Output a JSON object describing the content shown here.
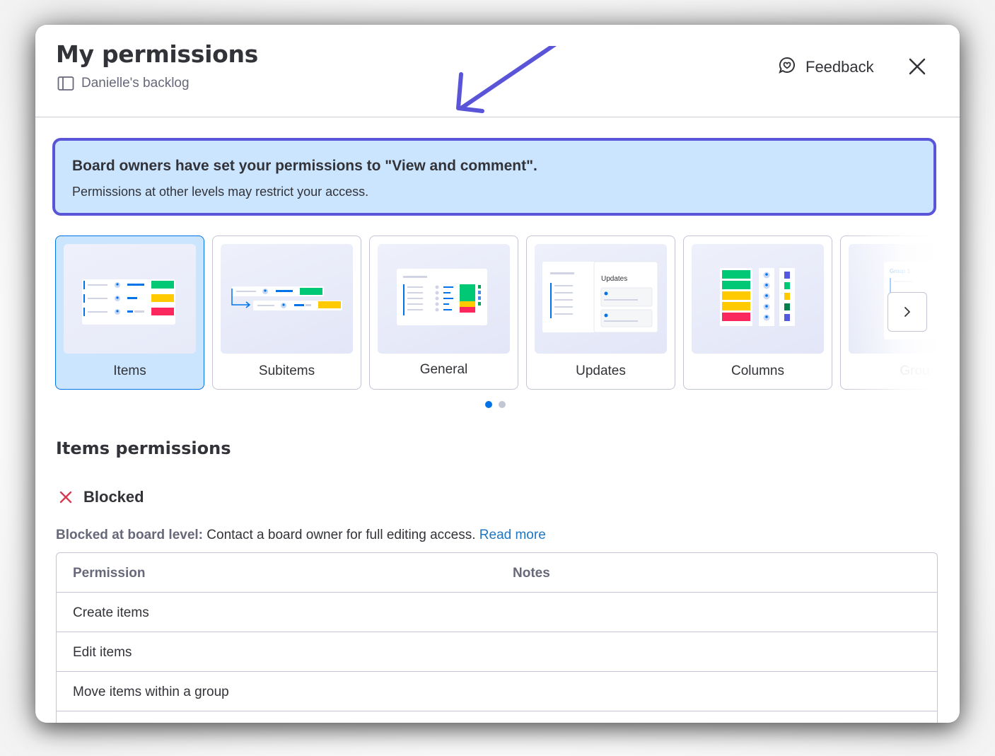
{
  "header": {
    "title": "My permissions",
    "board_name": "Danielle's backlog",
    "feedback_label": "Feedback"
  },
  "banner": {
    "title": "Board owners have set your permissions to \"View and comment\".",
    "text": "Permissions at other levels may restrict your access."
  },
  "carousel": {
    "cards": [
      {
        "label": "Items",
        "selected": true
      },
      {
        "label": "Subitems"
      },
      {
        "label": "General"
      },
      {
        "label": "Updates",
        "thumb_title": "Updates"
      },
      {
        "label": "Columns"
      },
      {
        "label": "Grou",
        "thumb_title": "Group 1"
      }
    ],
    "page": 1,
    "pages": 2
  },
  "section": {
    "title": "Items permissions",
    "status": "Blocked",
    "note_bold": "Blocked at board level:",
    "note_text": " Contact a board owner for full editing access. ",
    "note_link": "Read more"
  },
  "table": {
    "headers": [
      "Permission",
      "Notes"
    ],
    "rows": [
      "Create items",
      "Edit items",
      "Move items within a group"
    ]
  },
  "colors": {
    "accent": "#0073ea",
    "banner_bg": "#cce5ff",
    "banner_border": "#5a55d8",
    "blocked": "#d83a52",
    "annotation_arrow": "#5a55d8"
  },
  "icons": {
    "board": "board-icon",
    "feedback": "feedback-chat-icon",
    "close": "close-icon",
    "blocked": "x-mark-icon",
    "next": "chevron-right-icon"
  }
}
